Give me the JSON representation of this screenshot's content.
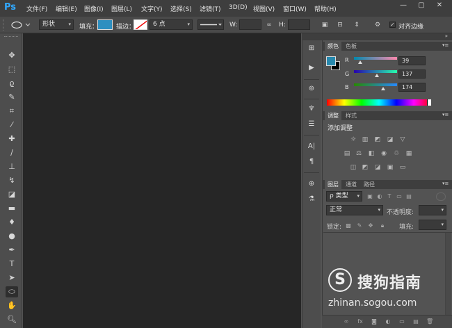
{
  "app": {
    "logo": "Ps",
    "window_controls": [
      "—",
      "▢",
      "✕"
    ]
  },
  "menus": [
    "文件(F)",
    "编辑(E)",
    "图像(I)",
    "图层(L)",
    "文字(Y)",
    "选择(S)",
    "滤镜(T)",
    "3D(D)",
    "视图(V)",
    "窗口(W)",
    "帮助(H)"
  ],
  "options": {
    "mode_value": "形状",
    "fill_label": "填充：",
    "fill_color": "#2e8fc0",
    "stroke_label": "描边：",
    "stroke_width": "6 点",
    "w_label": "W:",
    "h_label": "H:",
    "align_label": "对齐边缘"
  },
  "color_panel": {
    "tabs": [
      "颜色",
      "色板"
    ],
    "foreground": "#2789ae",
    "channels": [
      {
        "label": "R",
        "value": "39",
        "level": 0.153
      },
      {
        "label": "G",
        "value": "137",
        "level": 0.537
      },
      {
        "label": "B",
        "value": "174",
        "level": 0.682
      }
    ]
  },
  "adjust_panel": {
    "tabs": [
      "调整",
      "样式"
    ],
    "title": "添加调整"
  },
  "layers_panel": {
    "tabs": [
      "图层",
      "通道",
      "路径"
    ],
    "filter_label": "ρ 类型",
    "blend_mode": "正常",
    "opacity_label": "不透明度:",
    "lock_label": "锁定:",
    "fill_label": "填充:"
  },
  "watermark": {
    "logo": "S",
    "brand": "搜狗指南",
    "url": "zhinan.sogou.com"
  }
}
